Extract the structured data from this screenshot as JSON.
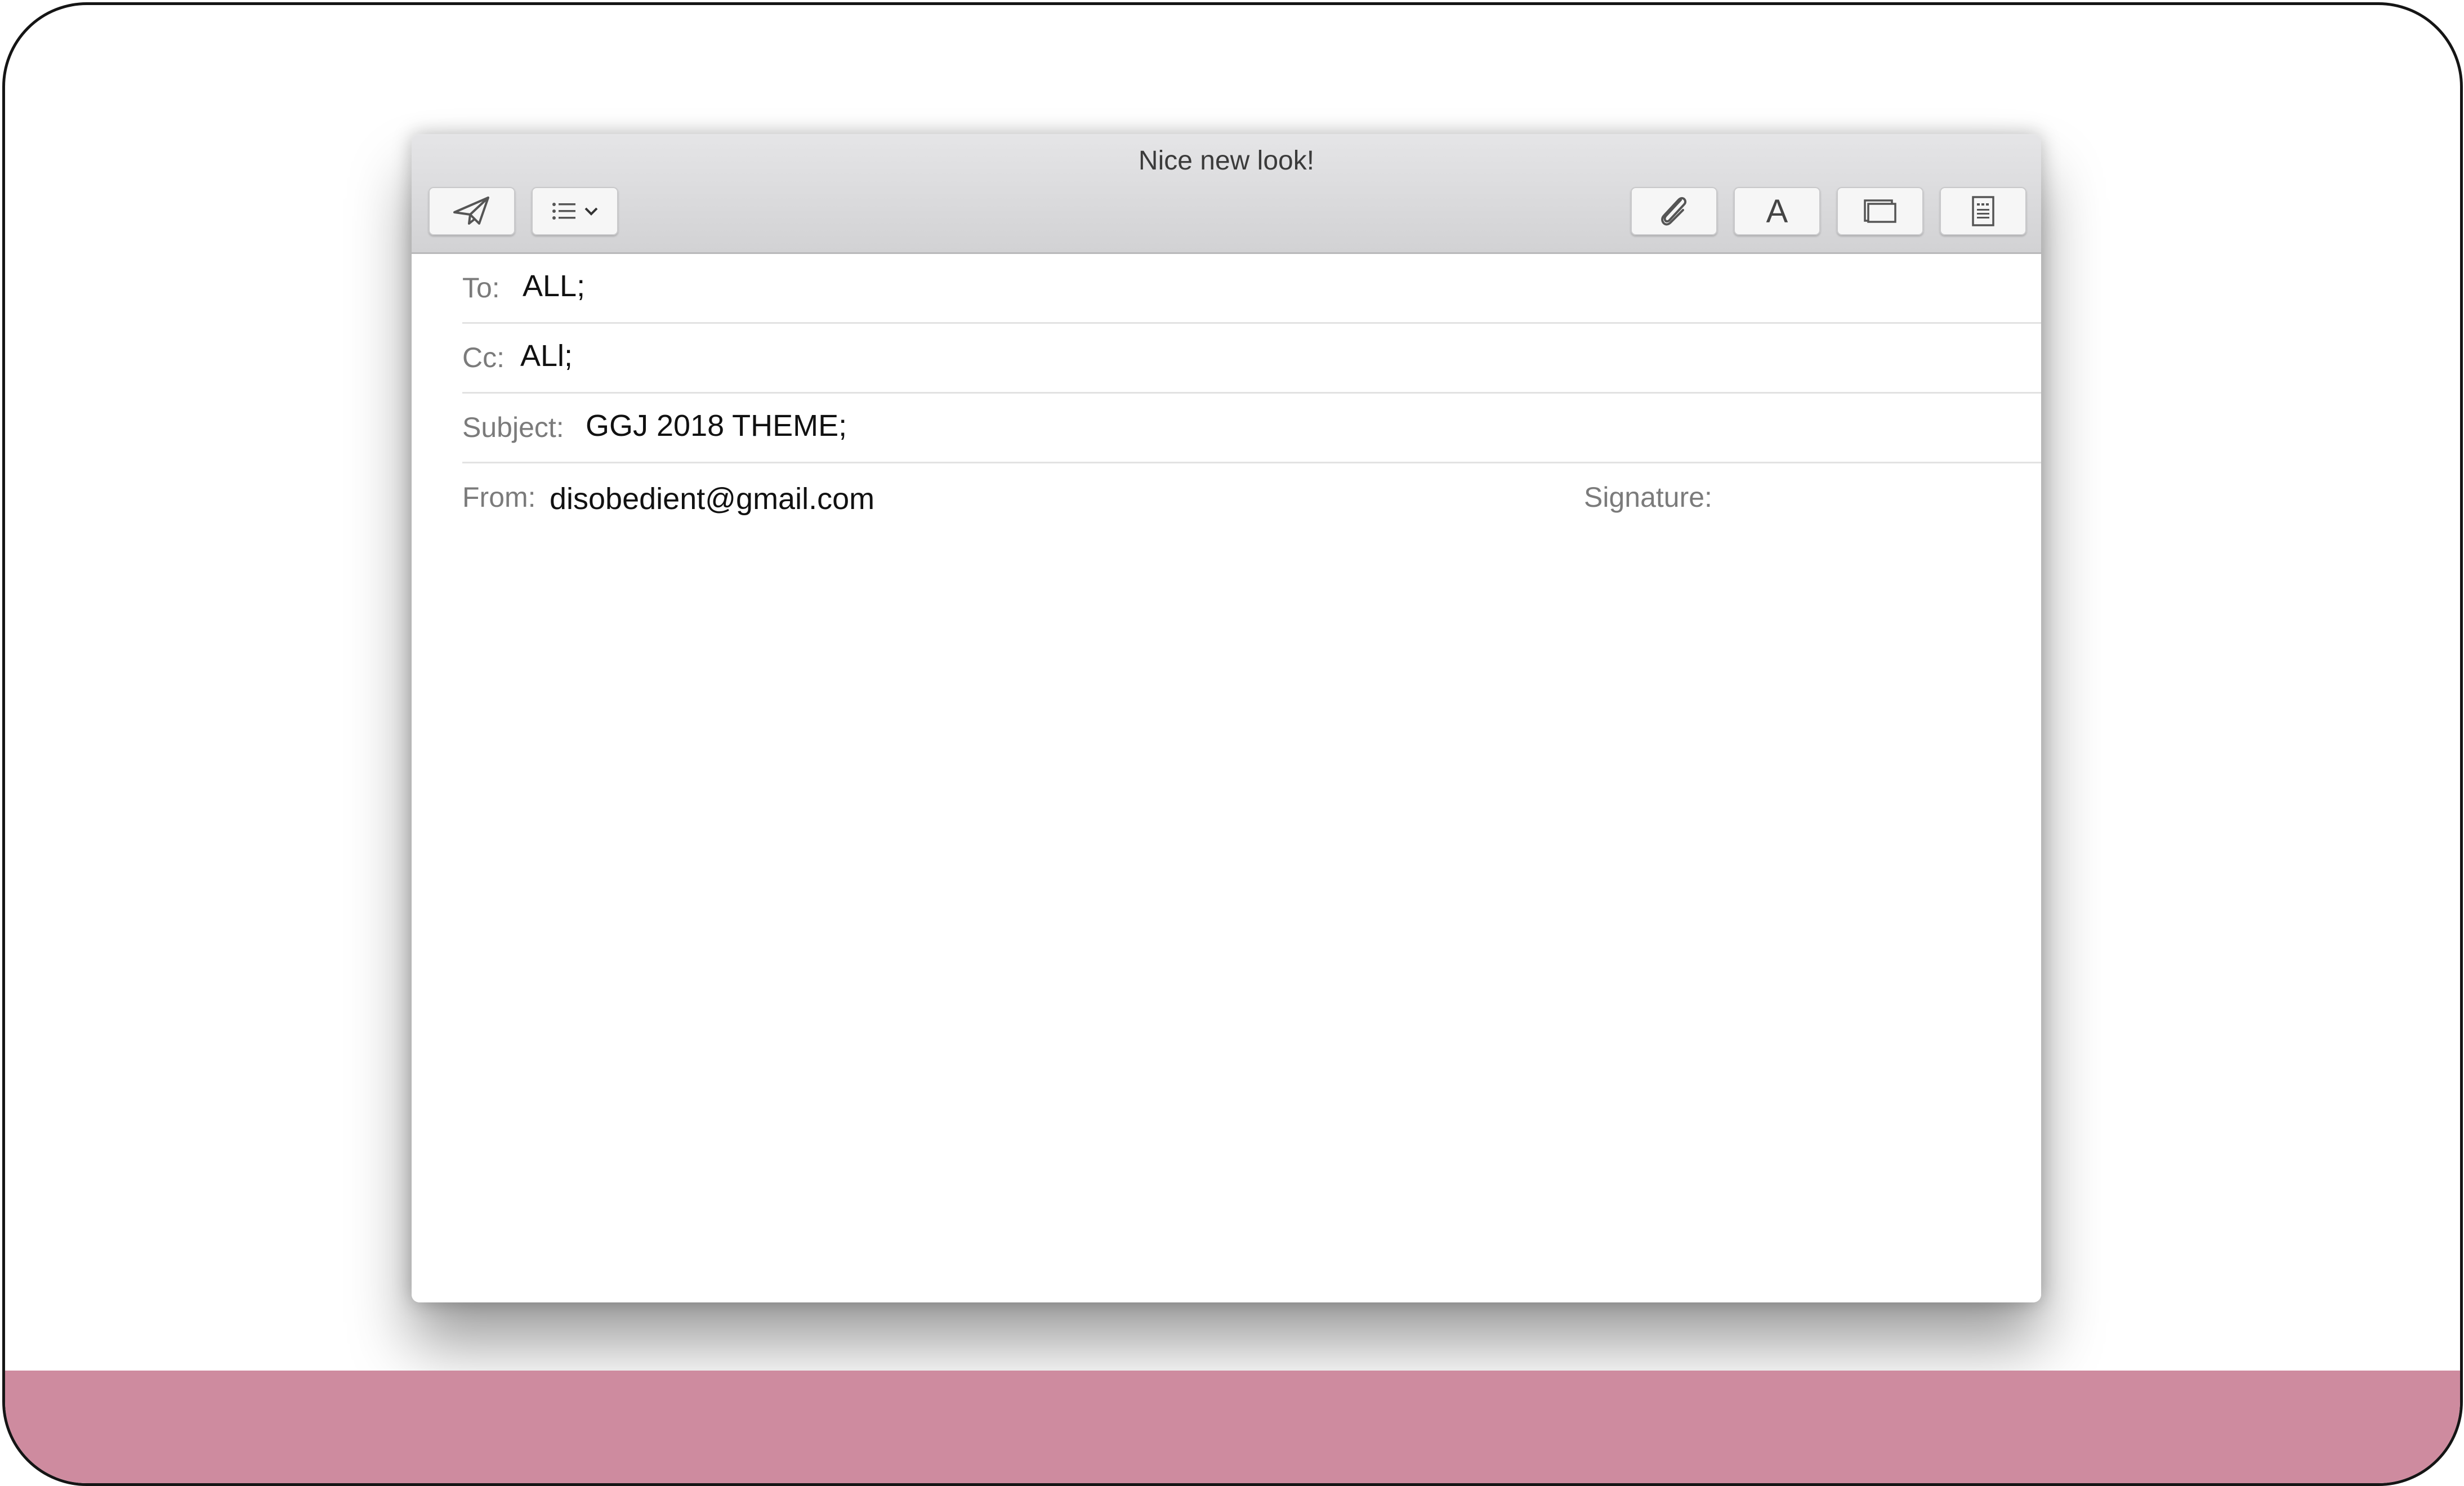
{
  "window": {
    "title": "Nice new look!"
  },
  "toolbar": {
    "left_buttons": [
      {
        "icon": "send-icon"
      },
      {
        "icon": "list-format-icon"
      }
    ],
    "right_buttons": [
      {
        "icon": "paperclip-icon"
      },
      {
        "icon": "font-icon",
        "label": "A"
      },
      {
        "icon": "photo-browser-icon"
      },
      {
        "icon": "stationery-icon"
      }
    ]
  },
  "header": {
    "to": {
      "label": "To:",
      "value": "ALL;"
    },
    "cc": {
      "label": "Cc:",
      "value": "ALl;"
    },
    "subject": {
      "label": "Subject:",
      "value": "GGJ 2018 THEME;"
    },
    "from": {
      "label": "From:",
      "value": "disobedient@gmail.com"
    },
    "signature": {
      "label": "Signature:",
      "value": ""
    }
  },
  "colors": {
    "bottom_band": "#ce8b9f",
    "frame_border": "#151515",
    "titlebar": "#dcdcde"
  }
}
